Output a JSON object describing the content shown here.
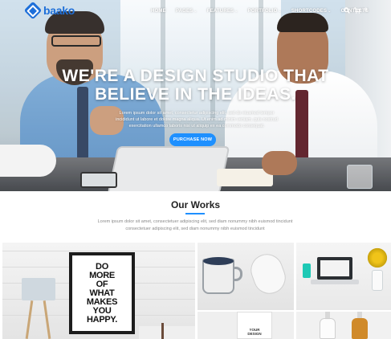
{
  "brand": {
    "name": "baako",
    "accent": "#1e90ff",
    "logo_color": "#1e6fd9"
  },
  "nav": {
    "items": [
      {
        "label": "HOME",
        "has_caret": false
      },
      {
        "label": "PAGES",
        "has_caret": true
      },
      {
        "label": "FEATURES",
        "has_caret": true
      },
      {
        "label": "PORTFOLIO",
        "has_caret": true
      },
      {
        "label": "SHORTCODES",
        "has_caret": true
      },
      {
        "label": "CONTACTS",
        "has_caret": false
      }
    ],
    "search_icon": "search-icon",
    "cart_icon": "cart-icon",
    "cart_count": "0"
  },
  "hero": {
    "title_line1": "WE'RE A DESIGN STUDIO THAT",
    "title_line2": "BELIEVE IN THE IDEAS.",
    "description": "Lorem ipsum dolor sit amet, consectetur adipiscing elit, sed do eiusmod tempor incididunt ut labore et dolore magna aliqua. Ut enim ad minim veniam, quis nostrud exercitation ullamco laboris nisi ut aliquip ex ea commodo consequat.",
    "button_label": "PURCHASE NOW"
  },
  "works": {
    "title": "Our Works",
    "description": "Lorem ipsum dolor sit amet, consectetuer adipiscing elit, sed diam nonummy nibh euismod tincidunt consectetuer adipiscing elit, sed diam nonummy nibh euismod tincidunt",
    "poster_lines": [
      "DO",
      "MORE",
      "OF",
      "WHAT",
      "MAKES",
      "YOU",
      "HAPPY."
    ],
    "card_lines": [
      "YOUR",
      "DESIGN"
    ]
  }
}
